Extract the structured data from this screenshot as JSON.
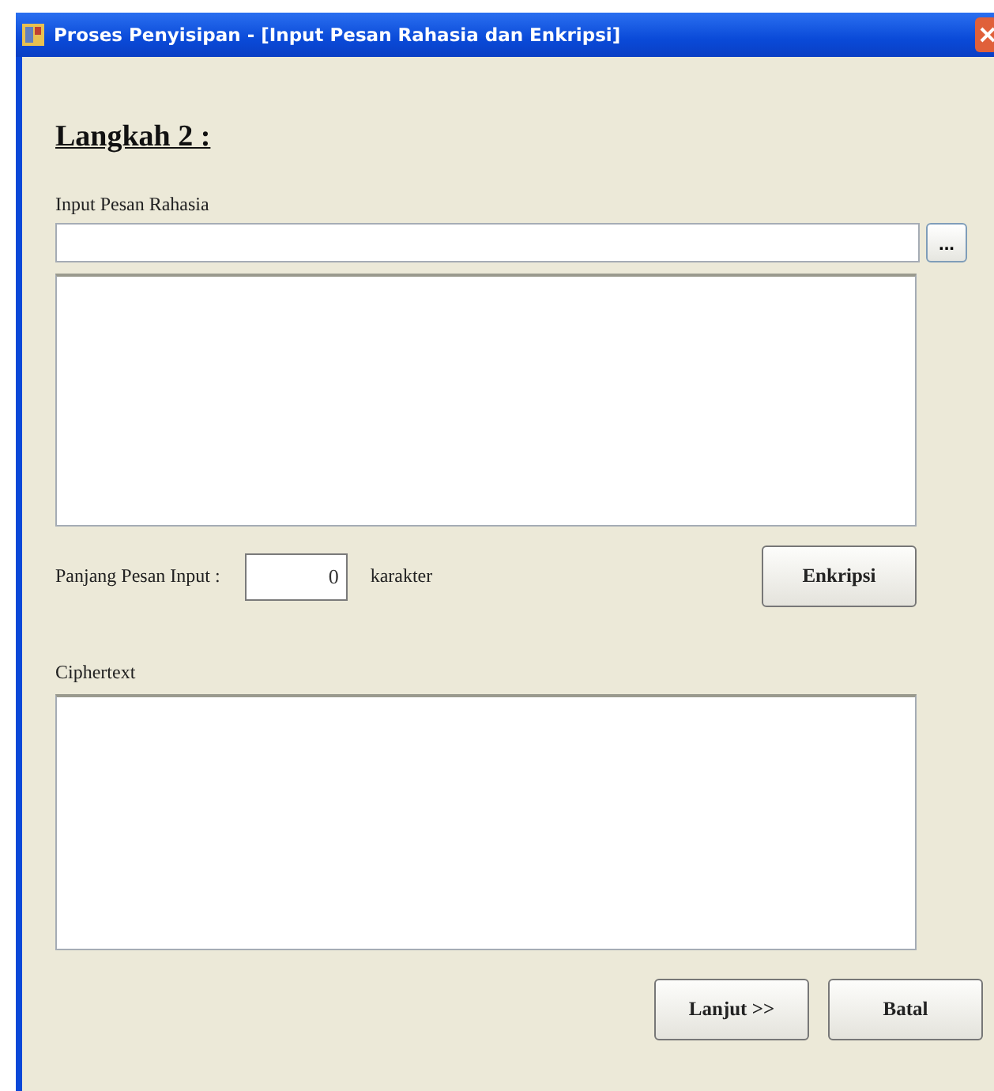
{
  "window": {
    "title": "Proses Penyisipan - [Input Pesan Rahasia dan Enkripsi]"
  },
  "heading": "Langkah 2 :",
  "message_input": {
    "label": "Input Pesan Rahasia",
    "browse_button": "..."
  },
  "length": {
    "label": "Panjang Pesan Input :",
    "value": "0",
    "unit": "karakter"
  },
  "encrypt_button": "Enkripsi",
  "ciphertext": {
    "label": "Ciphertext"
  },
  "buttons": [
    "Lanjut >>",
    "Batal"
  ]
}
